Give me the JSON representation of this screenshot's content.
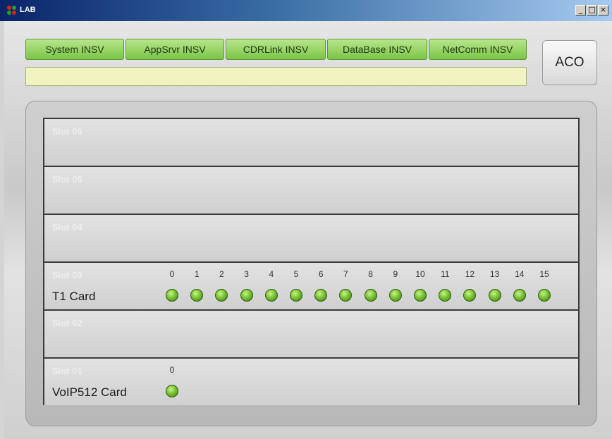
{
  "window": {
    "title": "LAB",
    "buttons": {
      "minimize": "_",
      "restore": "□",
      "close": "×"
    }
  },
  "status_tabs": [
    {
      "label": "System INSV"
    },
    {
      "label": "AppSrvr INSV"
    },
    {
      "label": "CDRLink INSV"
    },
    {
      "label": "DataBase INSV"
    },
    {
      "label": "NetComm INSV"
    }
  ],
  "status_colors": {
    "insv": "#7cc446",
    "led_on": "#79c233"
  },
  "message_bar": {
    "text": ""
  },
  "aco_button": {
    "label": "ACO"
  },
  "slots": [
    {
      "label": "Slot 06",
      "card": "",
      "ports": []
    },
    {
      "label": "Slot 05",
      "card": "",
      "ports": []
    },
    {
      "label": "Slot 04",
      "card": "",
      "ports": []
    },
    {
      "label": "Slot 03",
      "card": "T1 Card",
      "ports": [
        "0",
        "1",
        "2",
        "3",
        "4",
        "5",
        "6",
        "7",
        "8",
        "9",
        "10",
        "11",
        "12",
        "13",
        "14",
        "15"
      ]
    },
    {
      "label": "Slot 02",
      "card": "",
      "ports": []
    },
    {
      "label": "Slot 01",
      "card": "VoIP512 Card",
      "ports": [
        "0"
      ]
    }
  ]
}
